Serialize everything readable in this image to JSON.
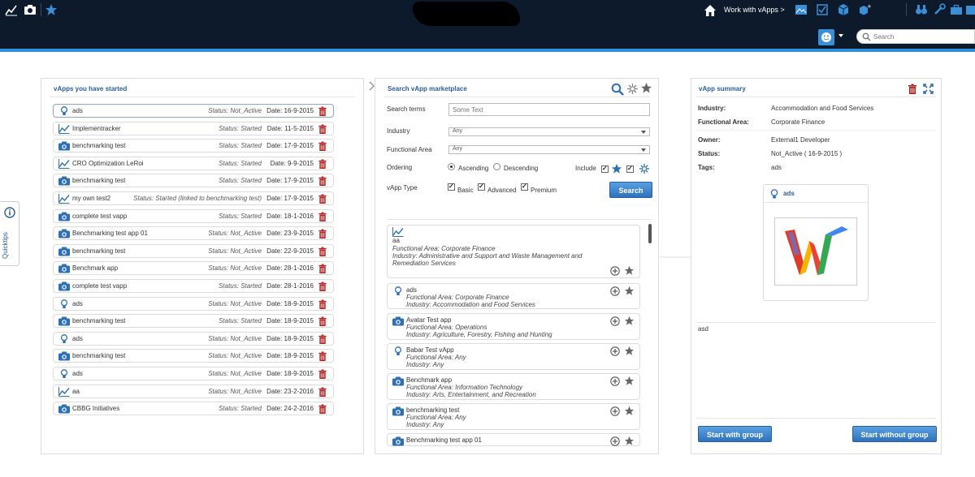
{
  "topbar": {
    "work_with": "Work with vApps >",
    "search_placeholder": "Search"
  },
  "quicktips": "Quicktips",
  "started_panel": {
    "title": "vApps you have started",
    "rows": [
      {
        "icon": "bulb",
        "name": "ads",
        "status": "Status: Not_Active",
        "date": "Date: 16-9-2015",
        "selected": true
      },
      {
        "icon": "chart",
        "name": "Implementracker",
        "status": "Status: Started",
        "date": "Date: 11-5-2015"
      },
      {
        "icon": "camera",
        "name": "benchmarking test",
        "status": "Status: Started",
        "date": "Date: 17-9-2015"
      },
      {
        "icon": "chart",
        "name": "CRO Optimization LeRoi",
        "status": "Status: Started",
        "date": "Date: 9-9-2015"
      },
      {
        "icon": "camera",
        "name": "benchmarking test",
        "status": "Status: Started",
        "date": "Date: 17-9-2015"
      },
      {
        "icon": "chart",
        "name": "my own test2",
        "status": "Status: Started (linked to benchmarking test)",
        "date": "Date: 17-9-2015"
      },
      {
        "icon": "camera",
        "name": "complete test vapp",
        "status": "Status: Started",
        "date": "Date: 18-1-2016"
      },
      {
        "icon": "camera",
        "name": "Benchmarking test app 01",
        "status": "Status: Not_Active",
        "date": "Date: 23-9-2015"
      },
      {
        "icon": "camera",
        "name": "benchmarking test",
        "status": "Status: Not_Active",
        "date": "Date: 22-9-2015"
      },
      {
        "icon": "camera",
        "name": "Benchmark app",
        "status": "Status: Not_Active",
        "date": "Date: 28-1-2016"
      },
      {
        "icon": "camera",
        "name": "complete test vapp",
        "status": "Status: Started",
        "date": "Date: 28-1-2016"
      },
      {
        "icon": "bulb",
        "name": "ads",
        "status": "Status: Not_Active",
        "date": "Date: 18-9-2015"
      },
      {
        "icon": "camera",
        "name": "benchmarking test",
        "status": "Status: Started",
        "date": "Date: 18-9-2015"
      },
      {
        "icon": "bulb",
        "name": "ads",
        "status": "Status: Not_Active",
        "date": "Date: 18-9-2015"
      },
      {
        "icon": "camera",
        "name": "benchmarking test",
        "status": "Status: Not_Active",
        "date": "Date: 18-9-2015"
      },
      {
        "icon": "bulb",
        "name": "ads",
        "status": "Status: Not_Active",
        "date": "Date: 18-9-2015"
      },
      {
        "icon": "chart",
        "name": "aa",
        "status": "Status: Not_Active",
        "date": "Date: 23-2-2016"
      },
      {
        "icon": "camera",
        "name": "CBBG Initiatives",
        "status": "Status: Started",
        "date": "Date: 24-2-2016"
      }
    ]
  },
  "market_panel": {
    "title": "Search vApp marketplace",
    "search_terms_label": "Search terms",
    "search_terms_placeholder": "Some Text",
    "industry_label": "Industry",
    "industry_value": "Any",
    "functional_area_label": "Functional Area",
    "functional_area_value": "Any",
    "ordering_label": "Ordering",
    "ascending": "Ascending",
    "descending": "Descending",
    "include_label": "Include",
    "vapp_type_label": "vApp Type",
    "basic": "Basic",
    "advanced": "Advanced",
    "premium": "Premium",
    "search_button": "Search",
    "results": [
      {
        "icon": "chart",
        "name": "aa",
        "fa": "Functional Area: Corporate Finance",
        "ind": "Industry: Administrative and Support and Waste Management and Remediation Services"
      },
      {
        "icon": "bulb",
        "name": "ads",
        "fa": "Functional Area: Corporate Finance",
        "ind": "Industry: Accommodation and Food Services"
      },
      {
        "icon": "camera",
        "name": "Avatar Test app",
        "fa": "Functional Area: Operations",
        "ind": "Industry: Agriculture, Forestry, Fishing and Hunting"
      },
      {
        "icon": "bulb",
        "name": "Babar Test vApp",
        "fa": "Functional Area: Any",
        "ind": "Industry: Any"
      },
      {
        "icon": "camera",
        "name": "Benchmark app",
        "fa": "Functional Area: Information Technology",
        "ind": "Industry: Arts, Entertainment, and Recreation"
      },
      {
        "icon": "camera",
        "name": "benchmarking test",
        "fa": "Functional Area: Any",
        "ind": "Industry: Any"
      },
      {
        "icon": "camera",
        "name": "Benchmarking test app 01",
        "fa": "",
        "ind": ""
      }
    ]
  },
  "summary_panel": {
    "title": "vApp summary",
    "industry_label": "Industry:",
    "industry_value": "Accommodation and Food Services",
    "fa_label": "Functional Area:",
    "fa_value": "Corporate Finance",
    "owner_label": "Owner:",
    "owner_value": "External1 Developer",
    "status_label": "Status:",
    "status_value": "Not_Active ( 16-9-2015 )",
    "tags_label": "Tags:",
    "tags_value": "ads",
    "card_name": "ads",
    "description": "asd",
    "start_with_group": "Start with group",
    "start_without_group": "Start without group"
  },
  "colors": {
    "topbar": "#0c1a2c",
    "accent": "#2e8fd8",
    "title_blue": "#2a5d9a",
    "trash_red": "#b2201f",
    "icon_blue": "#2f6fb3"
  }
}
